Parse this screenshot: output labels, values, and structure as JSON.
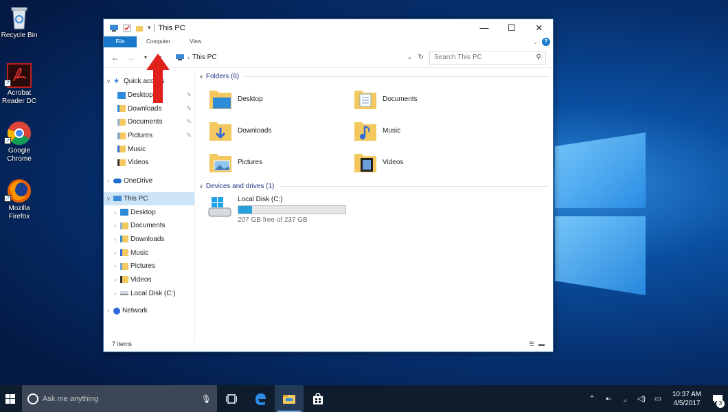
{
  "desktop": {
    "icons": [
      {
        "name": "recycle-bin",
        "label": "Recycle Bin"
      },
      {
        "name": "acrobat-reader",
        "label": "Acrobat Reader DC"
      },
      {
        "name": "google-chrome",
        "label": "Google Chrome"
      },
      {
        "name": "mozilla-firefox",
        "label": "Mozilla Firefox"
      }
    ]
  },
  "window": {
    "title": "This PC",
    "ribbon": {
      "file": "File",
      "computer": "Computer",
      "view": "View"
    },
    "address": {
      "path": "This PC",
      "search_placeholder": "Search This PC"
    },
    "nav": {
      "quick_access": "Quick access",
      "quick_items": [
        "Desktop",
        "Downloads",
        "Documents",
        "Pictures",
        "Music",
        "Videos"
      ],
      "onedrive": "OneDrive",
      "this_pc": "This PC",
      "pc_items": [
        "Desktop",
        "Documents",
        "Downloads",
        "Music",
        "Pictures",
        "Videos",
        "Local Disk (C:)"
      ],
      "network": "Network"
    },
    "folders_header": "Folders (6)",
    "folders": [
      "Desktop",
      "Documents",
      "Downloads",
      "Music",
      "Pictures",
      "Videos"
    ],
    "devices_header": "Devices and drives (1)",
    "drive": {
      "name": "Local Disk (C:)",
      "free_text": "207 GB free of 237 GB",
      "used_fraction": 0.127
    },
    "status": "7 items"
  },
  "taskbar": {
    "search_placeholder": "Ask me anything",
    "time": "10:37 AM",
    "date": "4/5/2017",
    "notification_count": "3"
  },
  "colors": {
    "accent": "#1979ca",
    "arrow": "#e0201b"
  }
}
